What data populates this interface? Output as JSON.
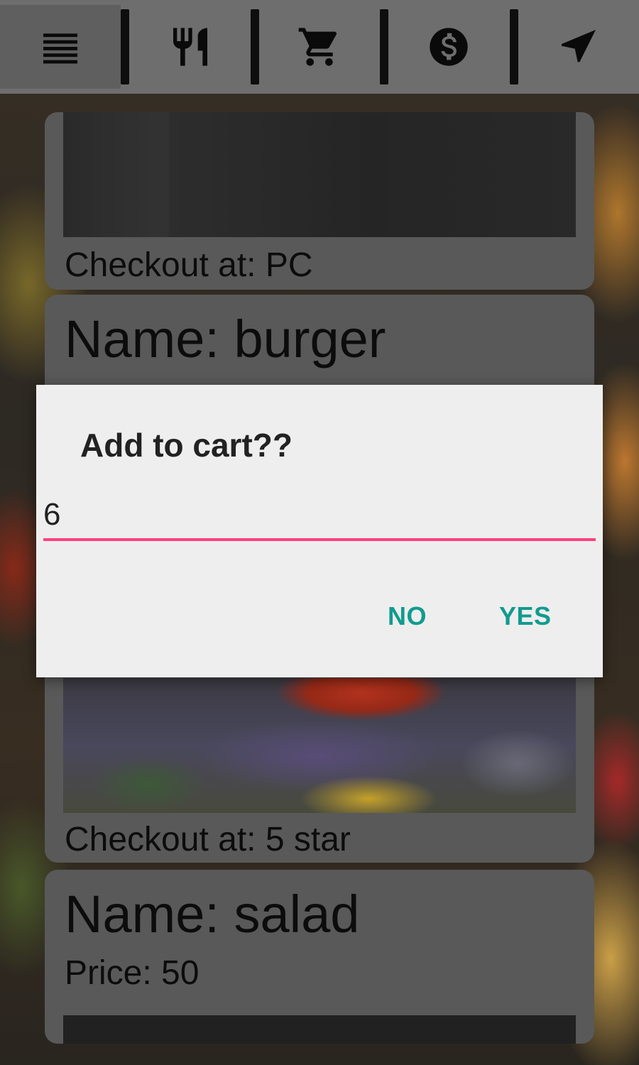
{
  "toolbar": {
    "items": [
      {
        "icon": "menu-icon",
        "active": true
      },
      {
        "icon": "restaurant-icon",
        "active": false
      },
      {
        "icon": "cart-icon",
        "active": false
      },
      {
        "icon": "dollar-icon",
        "active": false
      },
      {
        "icon": "navigation-icon",
        "active": false
      }
    ]
  },
  "cards": [
    {
      "checkout": "Checkout at: PC"
    },
    {
      "name": "Name:  burger"
    },
    {
      "checkout": "Checkout at: 5 star"
    },
    {
      "name": "Name:  salad",
      "price": "Price:  50"
    }
  ],
  "dialog": {
    "title": "Add to cart??",
    "input_value": "6",
    "no_label": "NO",
    "yes_label": "YES",
    "accent_color": "#ff4081",
    "button_color": "#119b8f"
  }
}
